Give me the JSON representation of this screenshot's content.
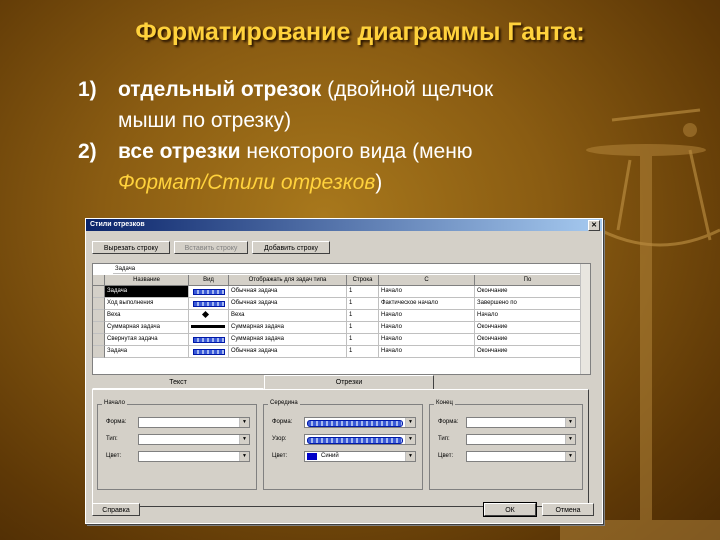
{
  "slide": {
    "title": "Форматирование диаграммы Ганта:",
    "item1_num": "1)",
    "item1_bold": "отдельный отрезок",
    "item1_rest": " (двойной щелчок",
    "item1_cont": "мыши по отрезку)",
    "item2_num": "2)",
    "item2_bold": "все отрезки",
    "item2_rest": " некоторого вида (меню",
    "item2_cont": "Формат/Стили отрезков",
    "item2_close": ")"
  },
  "dialog": {
    "title": "Стили отрезков",
    "close": "✕",
    "btn_cut": "Вырезать строку",
    "btn_paste": "Вставить строку",
    "btn_add": "Добавить строку",
    "edit_value": "Задача",
    "headers": [
      "Название",
      "Вид",
      "Отображать для задач типа",
      "Строка",
      "С",
      "По"
    ],
    "rows": [
      [
        "Задача",
        "",
        "Обычная задача",
        "1",
        "Начало",
        "Окончание"
      ],
      [
        "Ход выполнения",
        "",
        "Обычная задача",
        "1",
        "Фактическое начало",
        "Завершено по"
      ],
      [
        "Веха",
        "",
        "Веха",
        "1",
        "Начало",
        "Начало"
      ],
      [
        "Суммарная задача",
        "",
        "Суммарная задача",
        "1",
        "Начало",
        "Окончание"
      ],
      [
        "Свернутая задача",
        "",
        "Суммарная задача",
        "1",
        "Начало",
        "Окончание"
      ],
      [
        "Задача",
        "",
        "Обычная задача",
        "1",
        "Начало",
        "Окончание"
      ]
    ],
    "tab_text": "Текст",
    "tab_bars": "Отрезки",
    "group_start": "Начало",
    "group_middle": "Середина",
    "group_end": "Конец",
    "lbl_shape": "Форма:",
    "lbl_type": "Тип:",
    "lbl_color": "Цвет:",
    "lbl_pattern": "Узор:",
    "color_value": "Синий",
    "btn_help": "Справка",
    "btn_ok": "ОК",
    "btn_cancel": "Отмена"
  }
}
